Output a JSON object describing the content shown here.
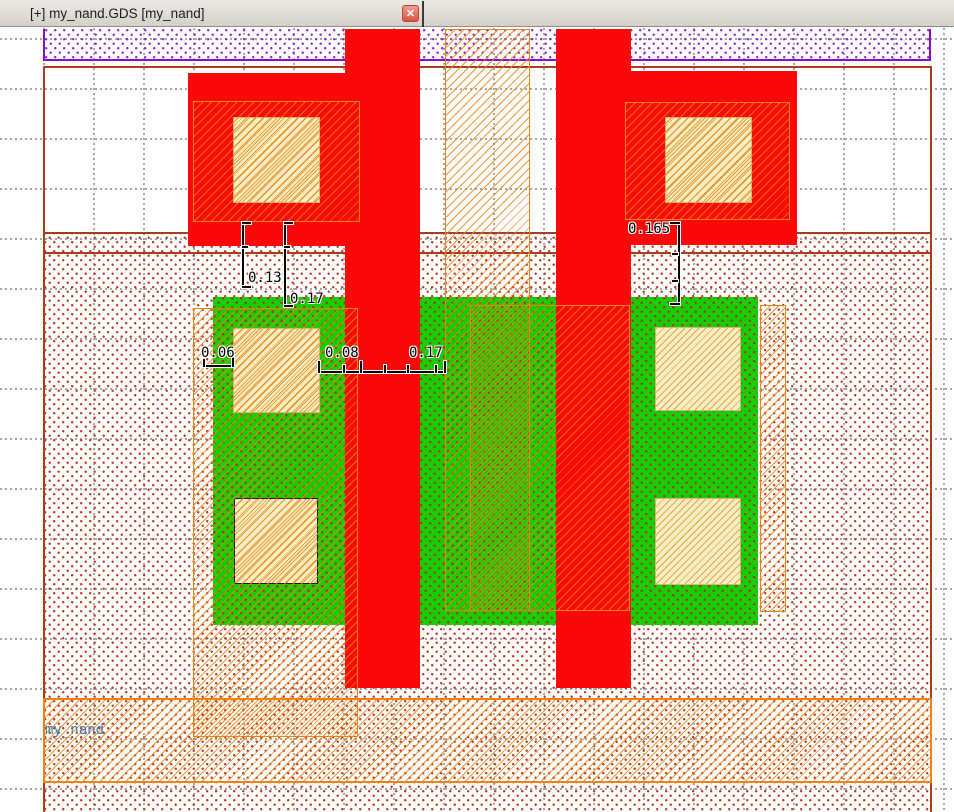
{
  "tab_bar": {
    "title": "[+] my_nand.GDS [my_nand]",
    "close_glyph": "✕"
  },
  "canvas": {
    "cell_label": "my_nand",
    "dimensions": {
      "left_gap_a": "0.13",
      "left_gap_b": "0.17",
      "right_gap": "0.165",
      "contact_margin": "0.06",
      "contact_to_gate": "0.08",
      "gate_pitch": "0.17"
    },
    "colors": {
      "metal_red": "#fb0808",
      "active_green": "#17ce05",
      "contact_khaki": "#f7efc3",
      "implant_hatch_orange": "#ee8212",
      "well_purple": "#8a0ad0",
      "boundary_brown": "#a83c1e",
      "implant_dot_red": "#c23a1d",
      "grid_dot_gray": "#969696",
      "cell_label_blue": "#3d7fae"
    }
  }
}
